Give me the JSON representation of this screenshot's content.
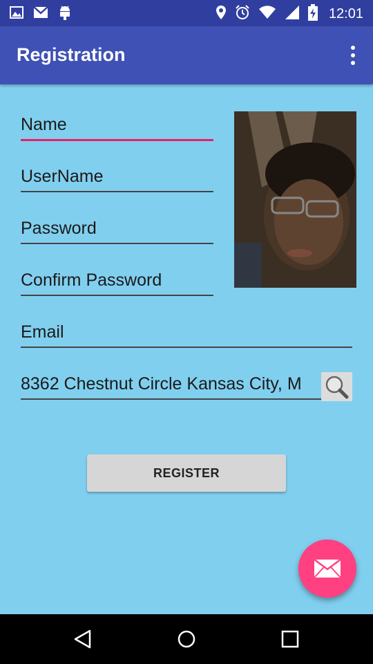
{
  "status_bar": {
    "time": "12:01",
    "icons": [
      "gallery-icon",
      "gmail-icon",
      "android-icon",
      "location-icon",
      "alarm-icon",
      "wifi-icon",
      "signal-icon",
      "battery-icon"
    ]
  },
  "app_bar": {
    "title": "Registration",
    "overflow_icon": "overflow-menu-icon"
  },
  "form": {
    "name": {
      "placeholder": "Name",
      "value": ""
    },
    "username": {
      "placeholder": "UserName",
      "value": ""
    },
    "password": {
      "placeholder": "Password",
      "value": ""
    },
    "confirm_password": {
      "placeholder": "Confirm Password",
      "value": ""
    },
    "email": {
      "placeholder": "Email",
      "value": ""
    },
    "address": {
      "value": "8362 Chestnut Circle Kansas City, M"
    }
  },
  "buttons": {
    "register": "REGISTER",
    "search_icon": "search-icon",
    "fab_icon": "mail-icon"
  },
  "colors": {
    "background": "#81CFEF",
    "app_bar": "#3F51B5",
    "status_bar": "#303F9F",
    "accent": "#FF4081",
    "focus_line": "#E91E63"
  }
}
